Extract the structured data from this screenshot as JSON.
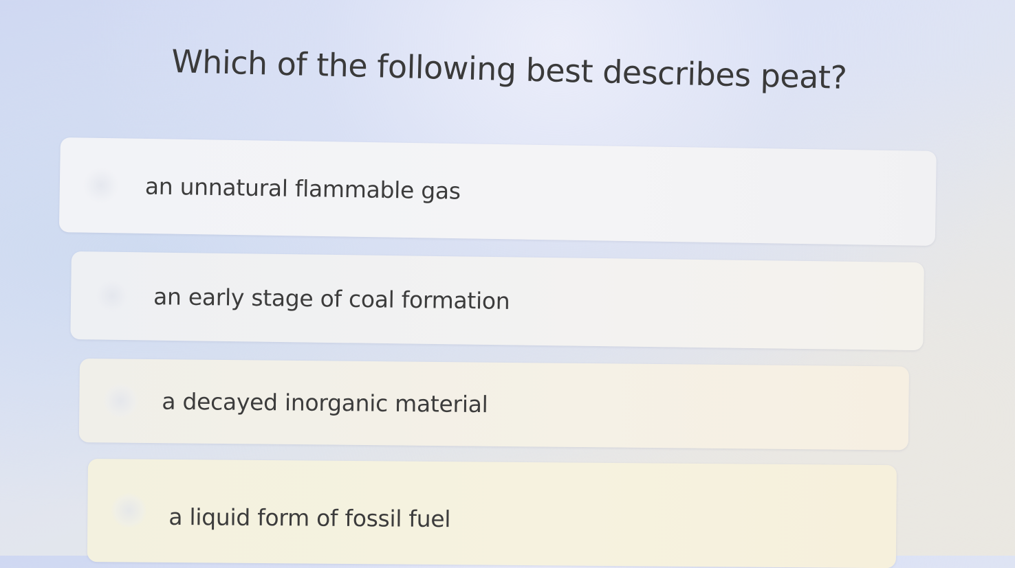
{
  "question": {
    "text": "Which of the following best describes peat?"
  },
  "options": [
    {
      "label": "an unnatural flammable gas"
    },
    {
      "label": "an early stage of coal formation"
    },
    {
      "label": "a decayed inorganic material"
    },
    {
      "label": "a liquid form of fossil fuel"
    }
  ],
  "colors": {
    "text": "#3c3c3c",
    "option_background": "#f3f3f5",
    "page_background": "#dde3f5"
  }
}
